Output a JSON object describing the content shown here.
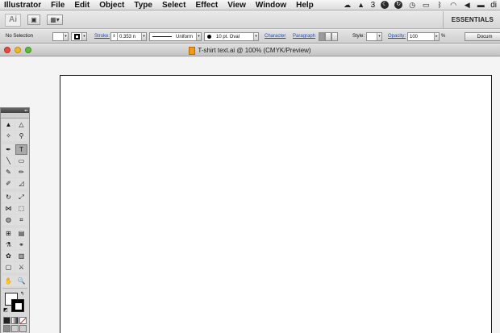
{
  "menubar": {
    "items": [
      "Illustrator",
      "File",
      "Edit",
      "Object",
      "Type",
      "Select",
      "Effect",
      "View",
      "Window",
      "Help"
    ],
    "status_icons": [
      "creative-cloud-icon",
      "adobe-icon",
      "moon-icon",
      "sync-icon",
      "time-machine-icon",
      "display-icon",
      "bluetooth-icon",
      "wifi-icon",
      "volume-icon",
      "battery-icon"
    ],
    "adobe_count": "3",
    "user_abbrev": "di"
  },
  "appbar": {
    "logo": "Ai",
    "workspace": "ESSENTIALS"
  },
  "control": {
    "selection": "No Selection",
    "stroke_label": "Stroke:",
    "stroke_value": "0.353 n",
    "profile": "Uniform",
    "brush": "10 pt. Oval",
    "character_link": "Character",
    "paragraph_link": "Paragraph",
    "style_label": "Style:",
    "opacity_label": "Opacity:",
    "opacity_value": "100",
    "percent": "%",
    "document_button": "Docum"
  },
  "document": {
    "title": "T-shirt text.ai @ 100% (CMYK/Preview)"
  },
  "tools": {
    "rows": [
      [
        "selection-tool",
        "direct-selection-tool"
      ],
      [
        "magic-wand-tool",
        "lasso-tool"
      ],
      [
        "pen-tool",
        "type-tool"
      ],
      [
        "line-segment-tool",
        "rectangle-tool"
      ],
      [
        "paintbrush-tool",
        "pencil-tool"
      ],
      [
        "blob-brush-tool",
        "eraser-tool"
      ],
      [
        "rotate-tool",
        "scale-tool"
      ],
      [
        "width-tool",
        "free-transform-tool"
      ],
      [
        "shape-builder-tool",
        "perspective-grid-tool"
      ],
      [
        "mesh-tool",
        "gradient-tool"
      ],
      [
        "eyedropper-tool",
        "blend-tool"
      ],
      [
        "symbol-sprayer-tool",
        "column-graph-tool"
      ],
      [
        "artboard-tool",
        "slice-tool"
      ],
      [
        "hand-tool",
        "zoom-tool"
      ]
    ],
    "glyphs": [
      [
        "▲",
        "△"
      ],
      [
        "✧",
        "⚲"
      ],
      [
        "✒",
        "T"
      ],
      [
        "╲",
        "▭"
      ],
      [
        "✎",
        "✏"
      ],
      [
        "✐",
        "◿"
      ],
      [
        "↻",
        "⤢"
      ],
      [
        "⋈",
        "⬚"
      ],
      [
        "◍",
        "⌗"
      ],
      [
        "⊞",
        "▤"
      ],
      [
        "⚗",
        "⚭"
      ],
      [
        "✿",
        "▥"
      ],
      [
        "▢",
        "⚔"
      ],
      [
        "✋",
        "🔍"
      ]
    ],
    "active": "type-tool"
  }
}
